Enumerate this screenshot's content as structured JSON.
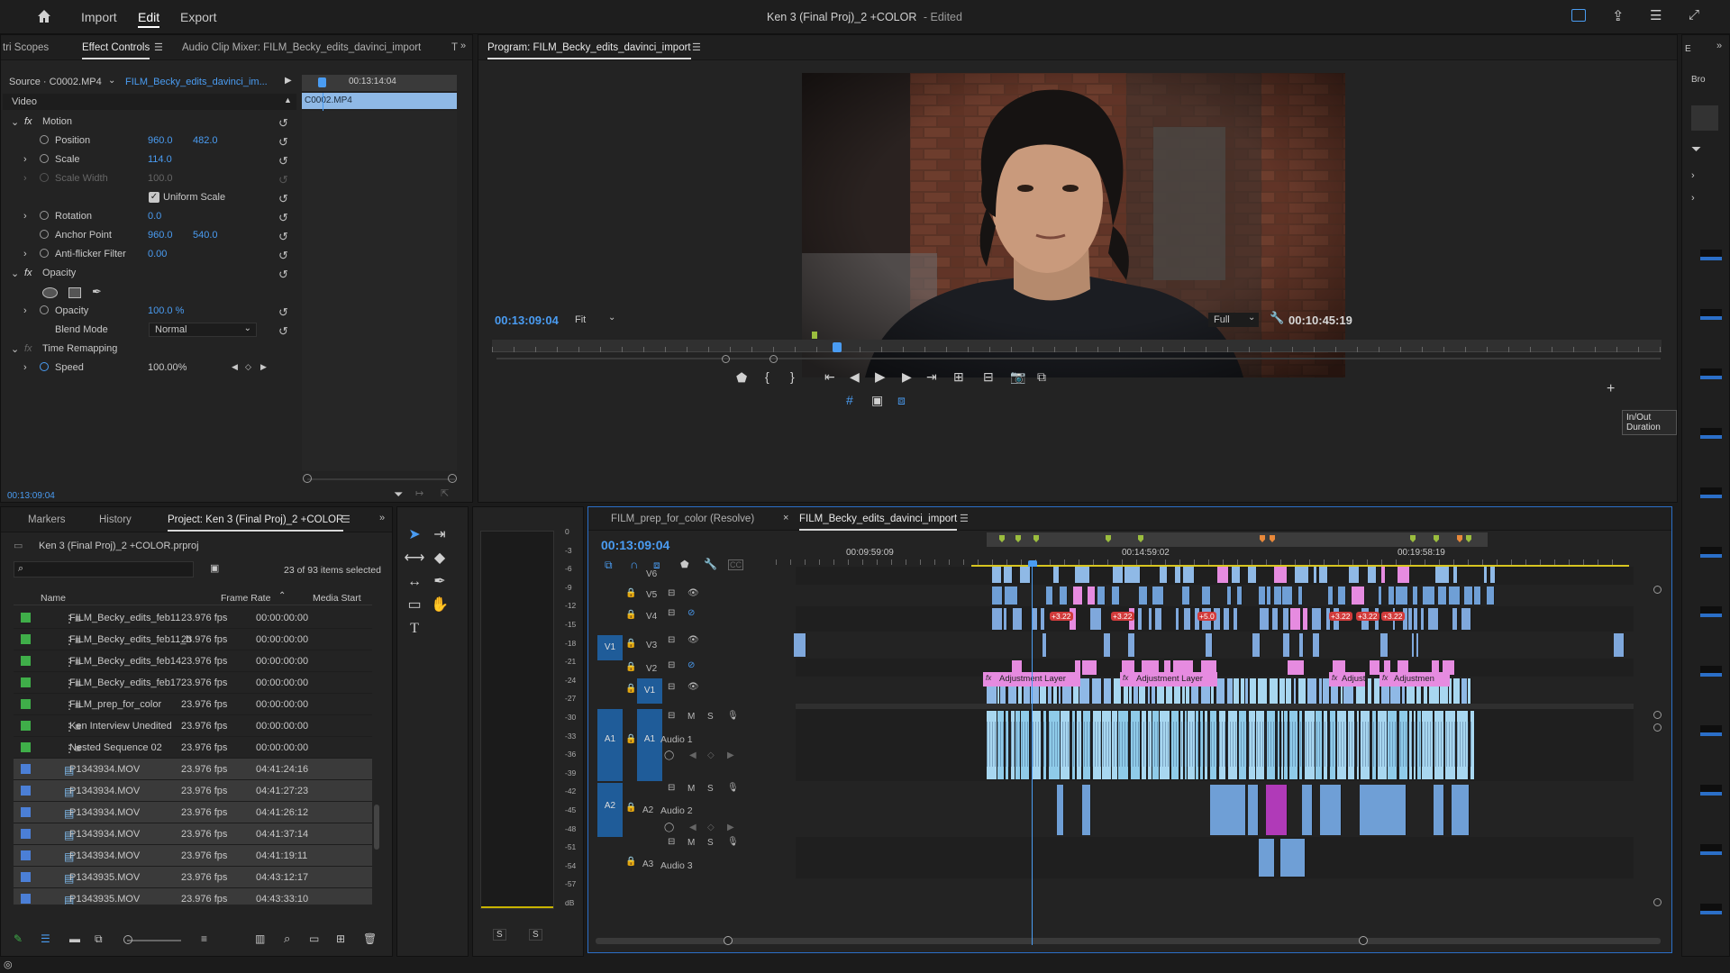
{
  "topbar": {
    "menu": [
      "Import",
      "Edit",
      "Export"
    ],
    "active_menu": "Edit",
    "title": "Ken 3 (Final Proj)_2 +COLOR",
    "edited": "- Edited"
  },
  "effect_controls": {
    "tabs": [
      "tri Scopes",
      "Effect Controls",
      "Audio Clip Mixer: FILM_Becky_edits_davinci_import",
      "T"
    ],
    "source_label": "Source · C0002.MP4",
    "sequence_label": "FILM_Becky_edits_davinci_im...",
    "timecode_ruler": "00:13:14:04",
    "clip_name": "C0002.MP4",
    "section_video": "Video",
    "motion": {
      "label": "Motion",
      "position_label": "Position",
      "position_x": "960.0",
      "position_y": "482.0",
      "scale_label": "Scale",
      "scale": "114.0",
      "scale_width_label": "Scale Width",
      "scale_width": "100.0",
      "uniform_scale_label": "Uniform Scale",
      "rotation_label": "Rotation",
      "rotation": "0.0",
      "anchor_label": "Anchor Point",
      "anchor_x": "960.0",
      "anchor_y": "540.0",
      "antiflicker_label": "Anti-flicker Filter",
      "antiflicker": "0.00"
    },
    "opacity": {
      "label": "Opacity",
      "opacity_label": "Opacity",
      "opacity": "100.0 %",
      "blend_label": "Blend Mode",
      "blend": "Normal"
    },
    "time_remap": {
      "label": "Time Remapping",
      "speed_label": "Speed",
      "speed": "100.00%"
    },
    "timecode": "00:13:09:04"
  },
  "program": {
    "title": "Program: FILM_Becky_edits_davinci_import",
    "timecode": "00:13:09:04",
    "fit": "Fit",
    "quality": "Full",
    "duration": "00:10:45:19",
    "tooltip": "In/Out Duration"
  },
  "project": {
    "tabs": [
      "Markers",
      "History",
      "Project: Ken 3 (Final Proj)_2 +COLOR"
    ],
    "file": "Ken 3 (Final Proj)_2 +COLOR.prproj",
    "selected_count": "23 of 93 items selected",
    "columns": [
      "Name",
      "Frame Rate",
      "Media Start"
    ],
    "rows": [
      {
        "name": "FILM_Becky_edits_feb11",
        "rate": "23.976 fps",
        "start": "00:00:00:00",
        "color": "#3fae49",
        "type": "seq",
        "sel": false
      },
      {
        "name": "FILM_Becky_edits_feb11_b",
        "rate": "23.976 fps",
        "start": "00:00:00:00",
        "color": "#3fae49",
        "type": "seq",
        "sel": false
      },
      {
        "name": "FILM_Becky_edits_feb14",
        "rate": "23.976 fps",
        "start": "00:00:00:00",
        "color": "#3fae49",
        "type": "seq",
        "sel": false
      },
      {
        "name": "FILM_Becky_edits_feb17",
        "rate": "23.976 fps",
        "start": "00:00:00:00",
        "color": "#3fae49",
        "type": "seq",
        "sel": false
      },
      {
        "name": "FILM_prep_for_color",
        "rate": "23.976 fps",
        "start": "00:00:00:00",
        "color": "#3fae49",
        "type": "seq",
        "sel": false
      },
      {
        "name": "Ken Interview Unedited",
        "rate": "23.976 fps",
        "start": "00:00:00:00",
        "color": "#3fae49",
        "type": "seq",
        "sel": false
      },
      {
        "name": "Nested Sequence 02",
        "rate": "23.976 fps",
        "start": "00:00:00:00",
        "color": "#3fae49",
        "type": "seq",
        "sel": false
      },
      {
        "name": "P1343934.MOV",
        "rate": "23.976 fps",
        "start": "04:41:24:16",
        "color": "#4b7fd6",
        "type": "clip",
        "sel": true
      },
      {
        "name": "P1343934.MOV",
        "rate": "23.976 fps",
        "start": "04:41:27:23",
        "color": "#4b7fd6",
        "type": "clip",
        "sel": true
      },
      {
        "name": "P1343934.MOV",
        "rate": "23.976 fps",
        "start": "04:41:26:12",
        "color": "#4b7fd6",
        "type": "clip",
        "sel": true
      },
      {
        "name": "P1343934.MOV",
        "rate": "23.976 fps",
        "start": "04:41:37:14",
        "color": "#4b7fd6",
        "type": "clip",
        "sel": true
      },
      {
        "name": "P1343934.MOV",
        "rate": "23.976 fps",
        "start": "04:41:19:11",
        "color": "#4b7fd6",
        "type": "clip",
        "sel": true
      },
      {
        "name": "P1343935.MOV",
        "rate": "23.976 fps",
        "start": "04:43:12:17",
        "color": "#4b7fd6",
        "type": "clip",
        "sel": true
      },
      {
        "name": "P1343935.MOV",
        "rate": "23.976 fps",
        "start": "04:43:33:10",
        "color": "#4b7fd6",
        "type": "clip",
        "sel": true
      }
    ]
  },
  "meter": {
    "scale": [
      "0",
      "-3",
      "-6",
      "-9",
      "-12",
      "-15",
      "-18",
      "-21",
      "-24",
      "-27",
      "-30",
      "-33",
      "-36",
      "-39",
      "-42",
      "-45",
      "-48",
      "-51",
      "-54",
      "-57",
      "dB"
    ],
    "solo": [
      "S",
      "S"
    ]
  },
  "timeline": {
    "tabs": [
      "FILM_prep_for_color (Resolve)",
      "FILM_Becky_edits_davinci_import"
    ],
    "timecode": "00:13:09:04",
    "ruler": [
      "00:09:59:09",
      "00:14:59:02",
      "00:19:58:19"
    ],
    "video_tracks": [
      "V6",
      "V5",
      "V4",
      "V3",
      "V2",
      "V1"
    ],
    "audio_tracks": [
      {
        "id": "A1",
        "name": "Audio 1"
      },
      {
        "id": "A2",
        "name": "Audio 2"
      },
      {
        "id": "A3",
        "name": "Audio 3"
      }
    ],
    "source_v": "V1",
    "source_a": [
      "A1",
      "A2"
    ],
    "adjustment_label": "Adjustment Layer",
    "adj_short": [
      "Adjust",
      "Adjustmen"
    ],
    "badge": "+3.22",
    "badge_alt": "+5.0",
    "btn_m": "M",
    "btn_s": "S"
  },
  "colors": {
    "accent": "#4a9cf2",
    "clip_video": "#8fb9e6",
    "clip_audio": "#a8d7f0",
    "adj": "#e68be0",
    "panel": "#232323"
  }
}
